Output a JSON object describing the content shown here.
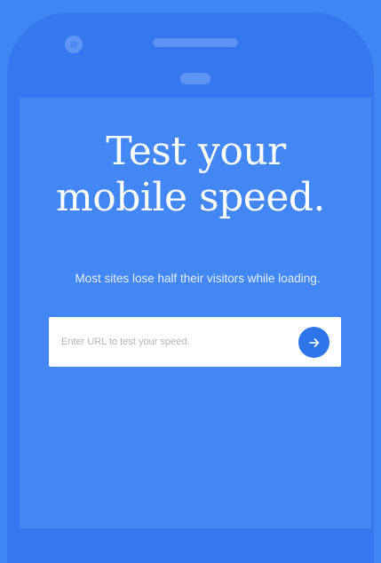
{
  "hero": {
    "headline_line1": "Test your",
    "headline_line2": "mobile speed.",
    "subtitle": "Most sites lose half their visitors while loading."
  },
  "url_form": {
    "placeholder": "Enter URL to test your speed.",
    "value": "",
    "submit_icon": "arrow-right-icon"
  },
  "colors": {
    "background": "#3f85f4",
    "phone_body": "#3477ef",
    "screen": "#4387f5",
    "submit_button": "#2f75ea",
    "text": "#ffffff"
  }
}
